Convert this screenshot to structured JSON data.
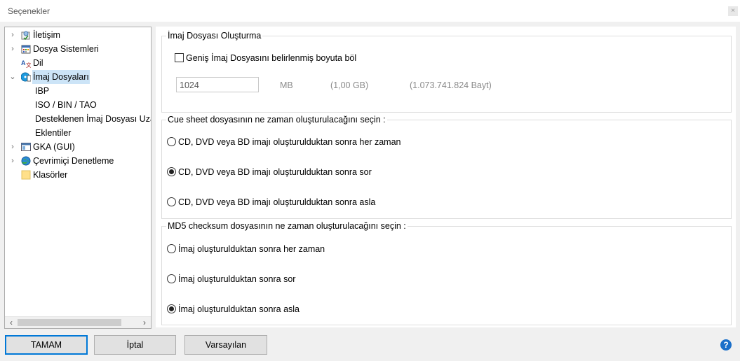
{
  "window": {
    "title": "Seçenekler",
    "close_glyph": "×"
  },
  "tree": {
    "items": [
      {
        "label": "İletişim",
        "icon": "communication-icon",
        "expander": "›",
        "selected": false
      },
      {
        "label": "Dosya Sistemleri",
        "icon": "filesystems-icon",
        "expander": "›",
        "selected": false
      },
      {
        "label": "Dil",
        "icon": "language-icon",
        "expander": "",
        "selected": false
      },
      {
        "label": "İmaj Dosyaları",
        "icon": "image-files-icon",
        "expander": "⌄",
        "selected": true
      },
      {
        "label": "IBP",
        "child": true
      },
      {
        "label": "ISO / BIN / TAO",
        "child": true
      },
      {
        "label": "Desteklenen İmaj Dosyası Uzantıları",
        "child": true
      },
      {
        "label": "Eklentiler",
        "child": true
      },
      {
        "label": "GKA (GUI)",
        "icon": "gui-icon",
        "expander": "›",
        "selected": false
      },
      {
        "label": "Çevrimiçi Denetleme",
        "icon": "online-check-icon",
        "expander": "›",
        "selected": false
      },
      {
        "label": "Klasörler",
        "icon": "folder-icon",
        "expander": "",
        "selected": false
      }
    ]
  },
  "image_creation": {
    "legend": "İmaj Dosyası Oluşturma",
    "split_checkbox_label": "Geniş İmaj Dosyasını belirlenmiş boyuta böl",
    "split_checked": false,
    "size_value": "1024",
    "size_unit": "MB",
    "size_gb": "(1,00 GB)",
    "size_bytes": "(1.073.741.824 Bayt)"
  },
  "cue_sheet": {
    "legend": "Cue sheet dosyasının ne zaman oluşturulacağını seçin :",
    "options": [
      {
        "label": "CD, DVD veya BD imajı oluşturulduktan sonra her zaman",
        "checked": false
      },
      {
        "label": "CD, DVD veya BD imajı oluşturulduktan sonra sor",
        "checked": true
      },
      {
        "label": "CD, DVD veya BD imajı oluşturulduktan sonra asla",
        "checked": false
      }
    ]
  },
  "md5": {
    "legend": "MD5 checksum dosyasının ne zaman oluşturulacağını seçin :",
    "options": [
      {
        "label": "İmaj oluşturulduktan sonra her zaman",
        "checked": false
      },
      {
        "label": "İmaj oluşturulduktan sonra sor",
        "checked": false
      },
      {
        "label": "İmaj oluşturulduktan sonra asla",
        "checked": true
      }
    ]
  },
  "buttons": {
    "ok": "TAMAM",
    "cancel": "İptal",
    "defaults": "Varsayılan",
    "help": "?"
  },
  "colors": {
    "accent": "#0078d7",
    "selection": "#cce4f7"
  }
}
